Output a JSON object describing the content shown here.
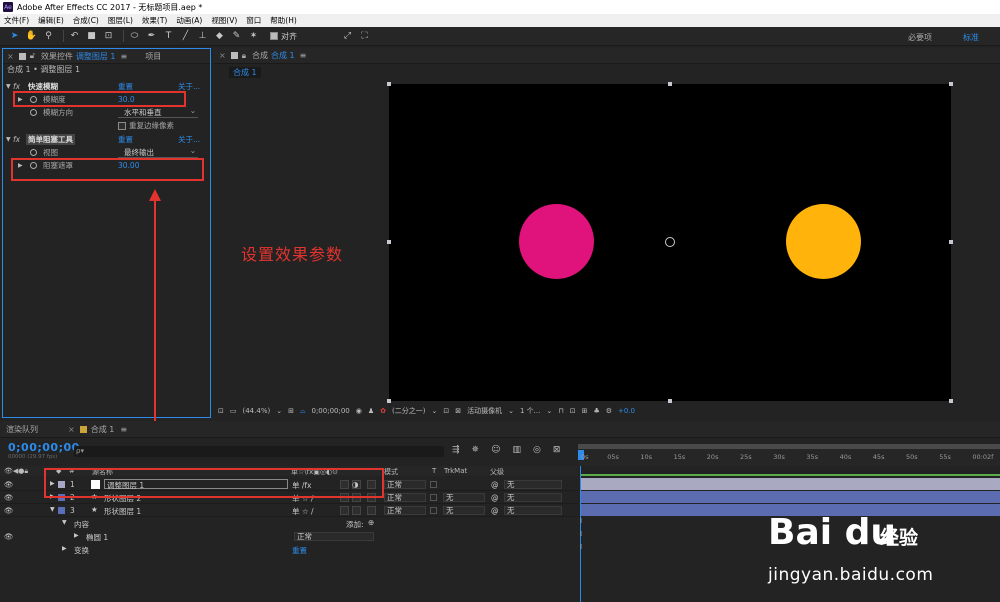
{
  "window": {
    "title": "Adobe After Effects CC 2017 - 无标题项目.aep *",
    "logo_text": "Ae"
  },
  "menu": [
    "文件(F)",
    "编辑(E)",
    "合成(C)",
    "图层(L)",
    "效果(T)",
    "动画(A)",
    "视图(V)",
    "窗口",
    "帮助(H)"
  ],
  "toolbar": {
    "snap_label": "对齐",
    "workspace_essentials": "必要项",
    "workspace_standard": "标准"
  },
  "effect_controls": {
    "tabs": {
      "close": "×",
      "title": "效果控件",
      "layer_link": "调整图层 1",
      "menu": "≡",
      "project": "项目"
    },
    "breadcrumb": "合成 1 • 调整图层 1",
    "effects": [
      {
        "name": "快速模糊",
        "reset": "重置",
        "about": "关于...",
        "props": [
          {
            "label": "模糊度",
            "value": "30.0"
          },
          {
            "label": "模糊方向",
            "value": "水平和垂直"
          },
          {
            "label": "重复边缘像素"
          }
        ]
      },
      {
        "name": "简单阻塞工具",
        "reset": "重置",
        "about": "关于...",
        "props": [
          {
            "label": "视图",
            "value": "最终输出"
          },
          {
            "label": "阻塞遮罩",
            "value": "30.00"
          }
        ]
      }
    ]
  },
  "composition": {
    "tab_title": "合成",
    "tab_link": "合成 1",
    "subtab": "合成 1",
    "annotation": "设置效果参数",
    "shapes": [
      {
        "name": "pink-circle",
        "color": "#E0127B"
      },
      {
        "name": "orange-circle",
        "color": "#FFB30B"
      }
    ],
    "viewer_bar": {
      "zoom": "(44.4%)",
      "timecode": "0;00;00;00",
      "resolution": "(二分之一)",
      "camera": "活动摄像机",
      "views": "1 个...",
      "exposure": "+0.0"
    }
  },
  "timeline": {
    "tabs": {
      "render_queue": "渲染队列",
      "comp": "合成 1"
    },
    "timecode": "0;00;00;00",
    "fps": "00000 (29.97 fps)",
    "search_placeholder": "ρ▾",
    "ruler_ticks": [
      "0s",
      "05s",
      "10s",
      "15s",
      "20s",
      "25s",
      "30s",
      "35s",
      "40s",
      "45s",
      "50s",
      "55s",
      "00:02f"
    ],
    "columns": {
      "num": "#",
      "source": "源名称",
      "switches": "单☆\\fx▣◎◐⊙",
      "mode": "模式",
      "t": "T",
      "trkmat": "TrkMat",
      "parent": "父级"
    },
    "layers": [
      {
        "num": "1",
        "name": "调整图层 1",
        "swatch": "#a7a7c8",
        "mode": "正常",
        "trkmat": "",
        "parent": "无",
        "bar": "#a9a9c1",
        "switches": "单   /fx"
      },
      {
        "num": "2",
        "name": "形状图层 2",
        "swatch": "#5a6fb9",
        "mode": "正常",
        "trkmat": "无",
        "parent": "无",
        "bar": "#5b6cb0",
        "switches": "单 ☆ /"
      },
      {
        "num": "3",
        "name": "形状图层 1",
        "swatch": "#5a6fb9",
        "mode": "正常",
        "trkmat": "无",
        "parent": "无",
        "bar": "#5b6cb0",
        "switches": "单 ☆ /"
      }
    ],
    "sub_rows": {
      "content": "内容",
      "add": "添加:",
      "ellipse": "椭圆 1",
      "ellipse_mode": "正常",
      "transform": "变换",
      "transform_reset": "重置"
    }
  },
  "watermark": {
    "logo": "Bai du",
    "cn": "经验",
    "url": "jingyan.baidu.com"
  }
}
